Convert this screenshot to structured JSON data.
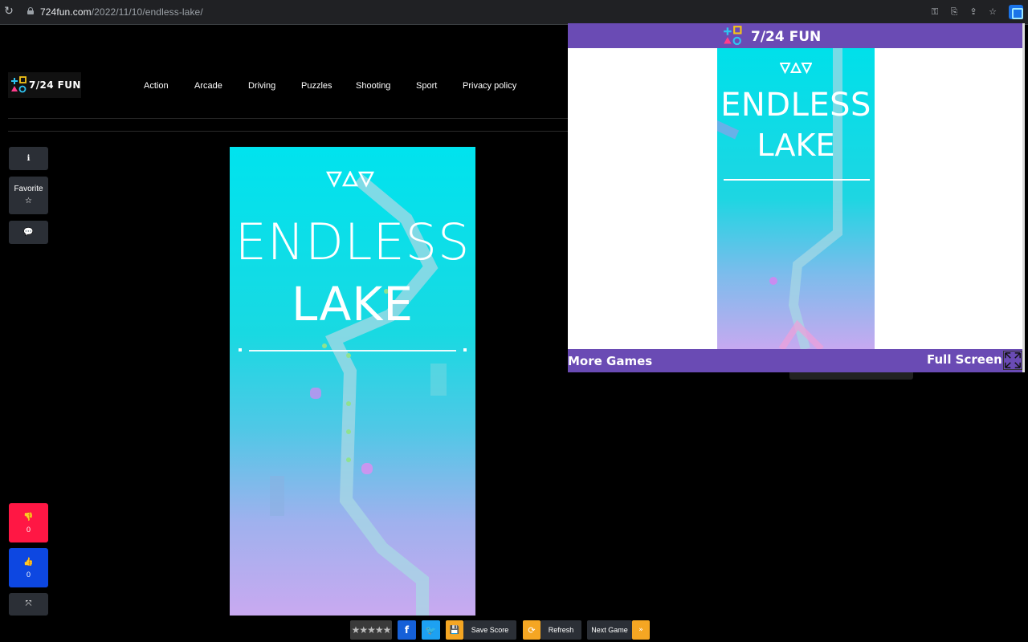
{
  "browser": {
    "url_host": "724fun.com",
    "url_path": "/2022/11/10/endless-lake/"
  },
  "site": {
    "logo_text": "7/24 FUN",
    "nav": [
      "Action",
      "Arcade",
      "Driving",
      "Puzzles",
      "Shooting",
      "Sport",
      "Privacy policy"
    ]
  },
  "sidebar": {
    "info_icon": "info-icon",
    "favorite_label": "Favorite",
    "favorite_icon": "star-icon",
    "comment_icon": "comment-icon",
    "dislike_count": "0",
    "like_count": "0"
  },
  "game": {
    "title_line1": "ENDLESS",
    "title_line2": "LAKE"
  },
  "toolbar": {
    "rating_stars": "★★★★★",
    "facebook": "f",
    "twitter": "t",
    "save_score": "Save Score",
    "refresh": "Refresh",
    "next_game": "Next Game"
  },
  "popup": {
    "logo_text": "7/24 FUN",
    "game_title_line1": "ENDLESS",
    "game_title_line2": "LAKE",
    "more_games": "More Games",
    "full_screen": "Full Screen"
  },
  "colors": {
    "popup_purple": "#6a4bb4",
    "dislike_red": "#ff1744",
    "like_blue": "#0d47e1",
    "accent_orange": "#f5a623",
    "game_cyan": "#00e3ee",
    "game_lilac": "#c9a9f0"
  }
}
